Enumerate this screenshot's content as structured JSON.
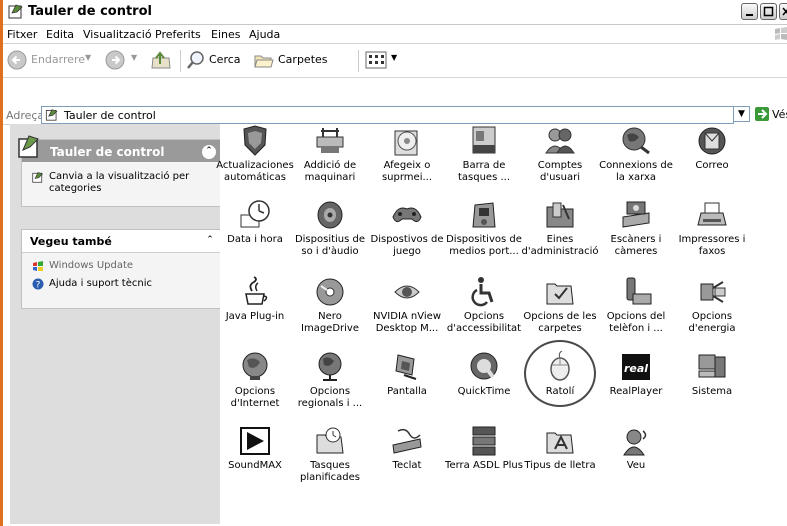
{
  "window": {
    "title": "Tauler de control",
    "accent_color": "#e07020"
  },
  "menu": [
    "Fitxer",
    "Edita",
    "Visualització",
    "Preferits",
    "Eines",
    "Ajuda"
  ],
  "toolbar": {
    "back_label": "Endarrere",
    "search_label": "Cerca",
    "folders_label": "Carpetes"
  },
  "address": {
    "label": "Adreça",
    "value": "Tauler de control",
    "go_label": "Vés"
  },
  "sidebar": {
    "main_panel_title": "Tauler de control",
    "main_panel_item": "Canvia a la visualització per categories",
    "see_also_title": "Vegeu també",
    "see_also_items": [
      "Windows Update",
      "Ajuda i suport tècnic"
    ]
  },
  "items": [
    {
      "label": "Actualizaciones automáticas",
      "icon": "shield-icon"
    },
    {
      "label": "Addició de maquinari",
      "icon": "hardware-icon"
    },
    {
      "label": "Afegeix o suprmei...",
      "icon": "cd-box-icon"
    },
    {
      "label": "Barra de tasques ...",
      "icon": "taskbar-icon"
    },
    {
      "label": "Comptes d'usuari",
      "icon": "users-icon"
    },
    {
      "label": "Connexions de la xarxa",
      "icon": "network-globe-icon"
    },
    {
      "label": "Correo",
      "icon": "mail-icon"
    },
    {
      "label": "Data i hora",
      "icon": "clock-icon"
    },
    {
      "label": "Dispositius de so i d'àudio",
      "icon": "speaker-icon"
    },
    {
      "label": "Dispostivos de juego",
      "icon": "joystick-icon"
    },
    {
      "label": "Dispositivos de medios port...",
      "icon": "media-device-icon"
    },
    {
      "label": "Eines d'administració",
      "icon": "admin-tools-icon"
    },
    {
      "label": "Escàners i càmeres",
      "icon": "scanner-icon"
    },
    {
      "label": "Impressores i faxos",
      "icon": "printer-icon"
    },
    {
      "label": "Java Plug-in",
      "icon": "java-icon"
    },
    {
      "label": "Nero ImageDrive",
      "icon": "nero-disc-icon"
    },
    {
      "label": "NVIDIA nView Desktop M...",
      "icon": "nvidia-icon"
    },
    {
      "label": "Opcions d'accessibilitat",
      "icon": "accessibility-icon"
    },
    {
      "label": "Opcions de les carpetes",
      "icon": "folder-options-icon"
    },
    {
      "label": "Opcions del telèfon i ...",
      "icon": "phone-modem-icon"
    },
    {
      "label": "Opcions d'energia",
      "icon": "power-icon"
    },
    {
      "label": "Opcions d'Internet",
      "icon": "internet-globe-icon"
    },
    {
      "label": "Opcions regionals i ...",
      "icon": "regional-globe-icon"
    },
    {
      "label": "Pantalla",
      "icon": "display-icon"
    },
    {
      "label": "QuickTime",
      "icon": "quicktime-icon"
    },
    {
      "label": "Ratolí",
      "icon": "mouse-icon"
    },
    {
      "label": "RealPlayer",
      "icon": "realplayer-icon"
    },
    {
      "label": "Sistema",
      "icon": "system-icon"
    },
    {
      "label": "SoundMAX",
      "icon": "soundmax-icon"
    },
    {
      "label": "Tasques planificades",
      "icon": "scheduled-tasks-icon"
    },
    {
      "label": "Teclat",
      "icon": "keyboard-icon"
    },
    {
      "label": "Terra ASDL Plus",
      "icon": "terra-adsl-icon"
    },
    {
      "label": "Tipus de lletra",
      "icon": "fonts-folder-icon"
    },
    {
      "label": "Veu",
      "icon": "speech-icon"
    }
  ],
  "realplayer_icon_text": "real"
}
